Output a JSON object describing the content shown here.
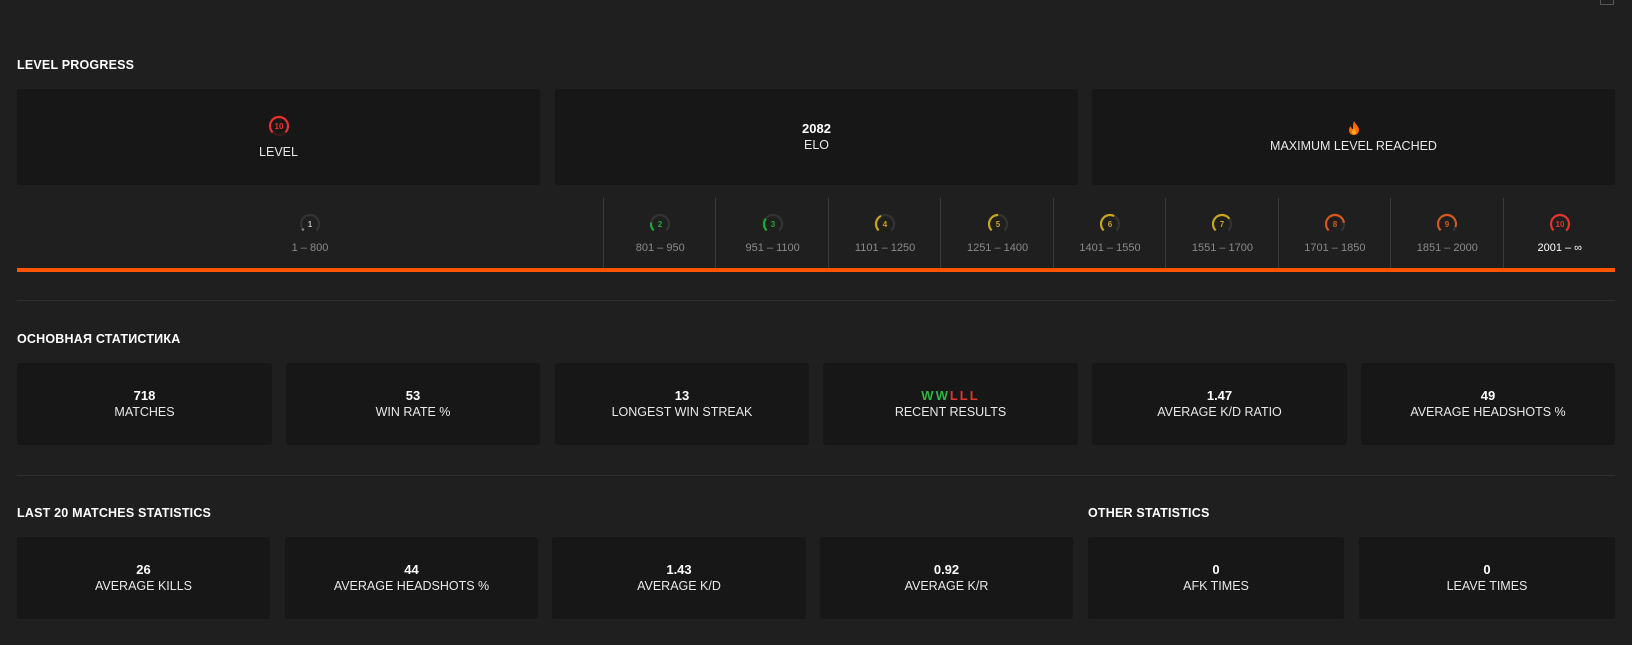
{
  "colors": {
    "accent": "#ff5500",
    "win": "#2fb344",
    "loss": "#e5322d"
  },
  "level_progress": {
    "title": "LEVEL PROGRESS",
    "level_card": {
      "level": "10",
      "label": "LEVEL"
    },
    "elo_card": {
      "value": "2082",
      "label": "ELO"
    },
    "max_card": {
      "icon": "flame-icon",
      "label": "MAXIMUM LEVEL REACHED"
    },
    "progress_fraction": 1.0,
    "levels": [
      {
        "level": "1",
        "range": "1 – 800",
        "color": "#888888",
        "fill": 0.05
      },
      {
        "level": "2",
        "range": "801 – 950",
        "color": "#1ea835",
        "fill": 0.2
      },
      {
        "level": "3",
        "range": "951 – 1100",
        "color": "#1ea835",
        "fill": 0.3
      },
      {
        "level": "4",
        "range": "1101 – 1250",
        "color": "#c8a41f",
        "fill": 0.4
      },
      {
        "level": "5",
        "range": "1251 – 1400",
        "color": "#c8a41f",
        "fill": 0.5
      },
      {
        "level": "6",
        "range": "1401 – 1550",
        "color": "#c8a41f",
        "fill": 0.6
      },
      {
        "level": "7",
        "range": "1551 – 1700",
        "color": "#c8a41f",
        "fill": 0.7
      },
      {
        "level": "8",
        "range": "1701 – 1850",
        "color": "#d4581c",
        "fill": 0.8
      },
      {
        "level": "9",
        "range": "1851 – 2000",
        "color": "#d4581c",
        "fill": 0.9
      },
      {
        "level": "10",
        "range": "2001 – ∞",
        "color": "#e5322d",
        "fill": 1.0
      }
    ]
  },
  "main_stats": {
    "title": "ОСНОВНАЯ СТАТИСТИКА",
    "matches": {
      "value": "718",
      "label": "MATCHES"
    },
    "win_rate": {
      "value": "53",
      "label": "WIN RATE %"
    },
    "longest_streak": {
      "value": "13",
      "label": "LONGEST WIN STREAK"
    },
    "recent_results": {
      "results": [
        "W",
        "W",
        "L",
        "L",
        "L"
      ],
      "label": "RECENT RESULTS"
    },
    "avg_kd": {
      "value": "1.47",
      "label": "AVERAGE K/D RATIO"
    },
    "avg_hs": {
      "value": "49",
      "label": "AVERAGE HEADSHOTS %"
    }
  },
  "last20": {
    "title": "LAST 20 MATCHES STATISTICS",
    "avg_kills": {
      "value": "26",
      "label": "AVERAGE KILLS"
    },
    "avg_hs": {
      "value": "44",
      "label": "AVERAGE HEADSHOTS %"
    },
    "avg_kd": {
      "value": "1.43",
      "label": "AVERAGE K/D"
    },
    "avg_kr": {
      "value": "0.92",
      "label": "AVERAGE K/R"
    }
  },
  "other": {
    "title": "OTHER STATISTICS",
    "afk": {
      "value": "0",
      "label": "AFK TIMES"
    },
    "leave": {
      "value": "0",
      "label": "LEAVE TIMES"
    }
  }
}
